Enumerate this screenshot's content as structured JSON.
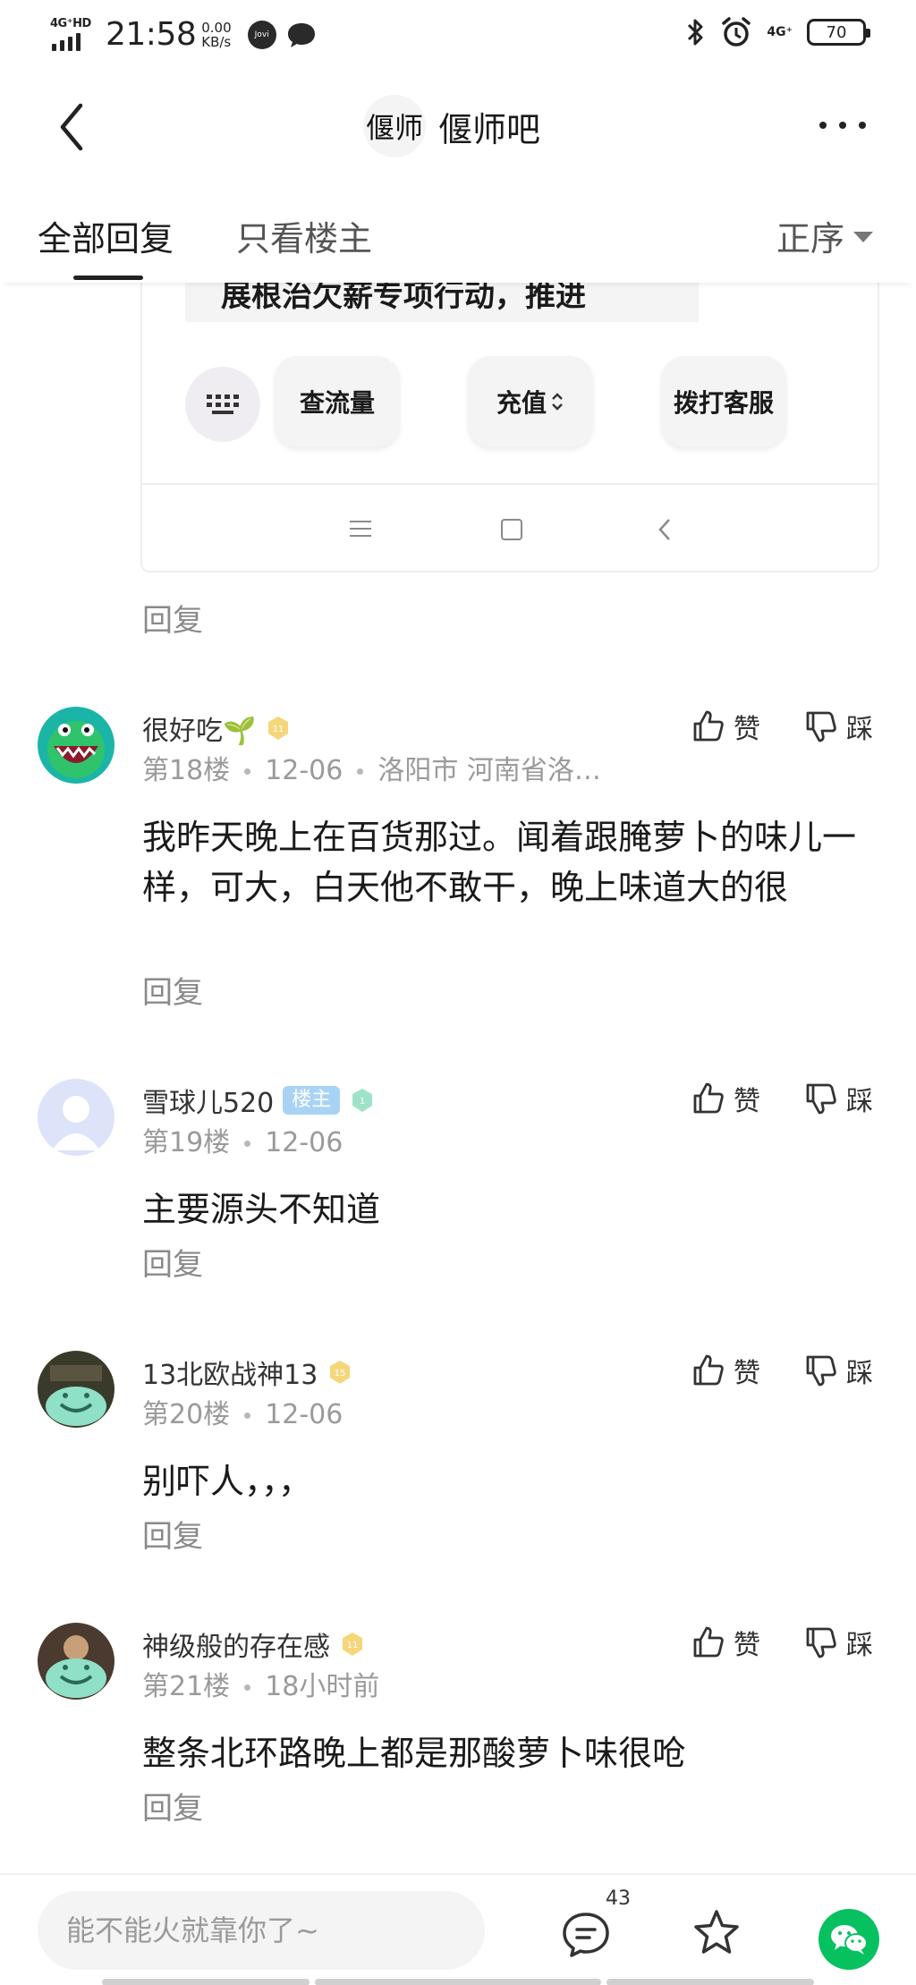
{
  "status_bar": {
    "network": "4G⁺HD",
    "time": "21:58",
    "speed_value": "0.00",
    "speed_unit": "KB/s",
    "jovi": "Jovi",
    "network2": "4G⁺",
    "battery": "70"
  },
  "header": {
    "logo_text": "偃师",
    "title": "偃师吧"
  },
  "tabs": {
    "all": "全部回复",
    "host_only": "只看楼主",
    "sort": "正序"
  },
  "embed": {
    "banner": "展根治欠薪专项行动，推进",
    "btn_traffic": "查流量",
    "btn_recharge": "充值",
    "btn_service": "拨打客服"
  },
  "reply_label": "回复",
  "like_label": "赞",
  "dislike_label": "踩",
  "comments": [
    {
      "username": "很好吃🌱",
      "level": "11",
      "floor": "第18楼",
      "date": "12-06",
      "location": "洛阳市 河南省洛…",
      "text": "我昨天晚上在百货那过。闻着跟腌萝卜的味儿一样，可大，白天他不敢干，晚上味道大的很"
    },
    {
      "username": "雪球儿520",
      "host_badge": "楼主",
      "level": "1",
      "floor": "第19楼",
      "date": "12-06",
      "text": "主要源头不知道"
    },
    {
      "username": "13北欧战神13",
      "level": "15",
      "floor": "第20楼",
      "date": "12-06",
      "text": "别吓人，，，"
    },
    {
      "username": "神级般的存在感",
      "level": "11",
      "floor": "第21楼",
      "date": "18小时前",
      "text": "整条北环路晚上都是那酸萝卜味很呛"
    }
  ],
  "bottom_bar": {
    "input_placeholder": "能不能火就靠你了~",
    "comment_count": "43"
  },
  "colors": {
    "accent_green": "#07c160",
    "level_gold": "#f5d67a",
    "level_teal": "#9ee3c8",
    "host_badge_bg": "#a8d3f5"
  }
}
